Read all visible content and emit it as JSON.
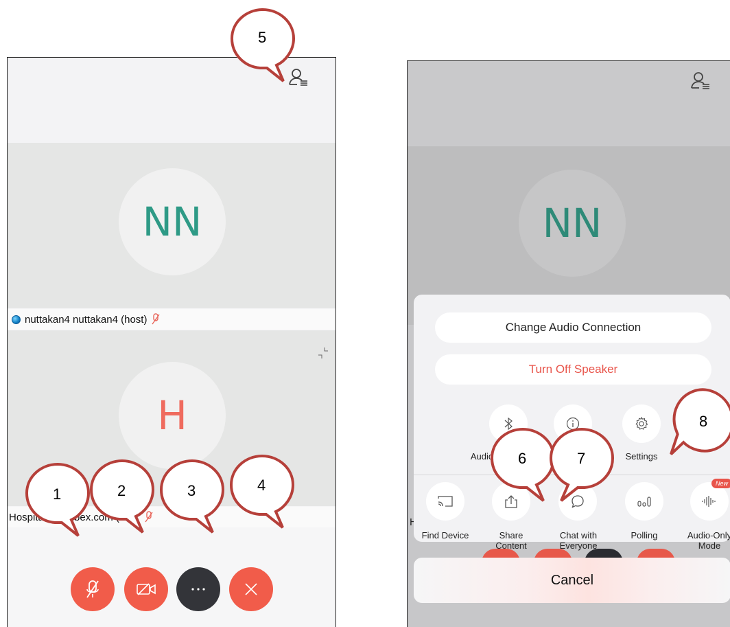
{
  "left": {
    "participant_1": {
      "initials": "NN",
      "name": "nuttakan4 nuttakan4 (host)"
    },
    "participant_2": {
      "initials": "H",
      "name": "Hospital-tu.webex.com (me)"
    }
  },
  "right": {
    "participant_initials": "NN",
    "change_audio_label": "Change Audio Connection",
    "turn_off_speaker_label": "Turn Off Speaker",
    "audio_device_label": "Audio D",
    "settings_label": "Settings",
    "find_device_label": "Find Device",
    "share_content_label": "Share\nContent",
    "chat_label": "Chat with\nEveryone",
    "polling_label": "Polling",
    "audio_only_label": "Audio-Only\nMode",
    "new_badge": "New",
    "cancel_label": "Cancel",
    "behind_letter": "H"
  },
  "callouts": [
    "1",
    "2",
    "3",
    "4",
    "5",
    "6",
    "7",
    "8"
  ],
  "colors": {
    "red": "#f15c4a",
    "teal": "#2e9a86",
    "salmon": "#ef6b5e",
    "dark": "#333439"
  }
}
